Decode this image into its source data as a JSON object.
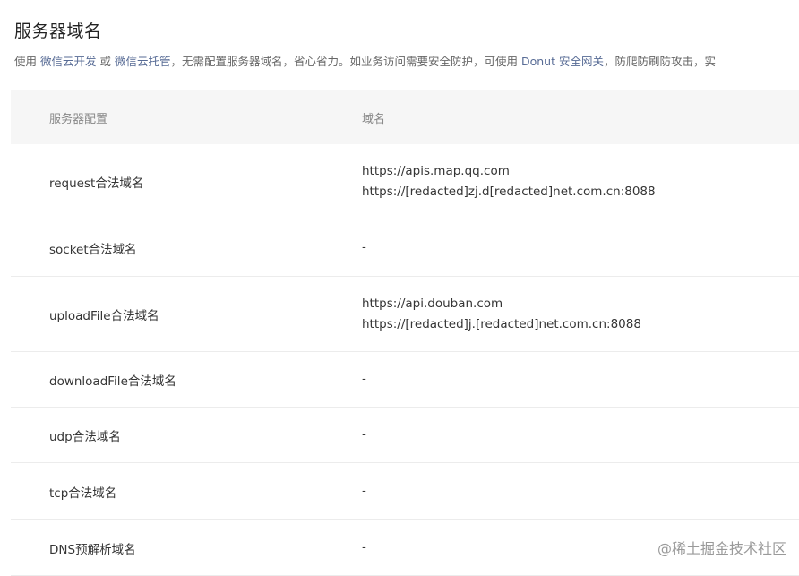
{
  "title": "服务器域名",
  "description": {
    "prefix": "使用 ",
    "link1": "微信云开发",
    "mid1": " 或 ",
    "link2": "微信云托管",
    "mid2": "，无需配置服务器域名，省心省力。如业务访问需要安全防护，可使用 ",
    "link3": "Donut 安全网关",
    "suffix": "，防爬防刷防攻击，实"
  },
  "table": {
    "headers": {
      "config": "服务器配置",
      "domain": "域名"
    },
    "rows": [
      {
        "name": "request合法域名",
        "values": [
          "https://apis.map.qq.com",
          "https://[redacted]zj.d[redacted]net.com.cn:8088"
        ]
      },
      {
        "name": "socket合法域名",
        "values": [
          "-"
        ]
      },
      {
        "name": "uploadFile合法域名",
        "values": [
          "https://api.douban.com",
          "https://[redacted]j.[redacted]net.com.cn:8088"
        ]
      },
      {
        "name": "downloadFile合法域名",
        "values": [
          "-"
        ]
      },
      {
        "name": "udp合法域名",
        "values": [
          "-"
        ]
      },
      {
        "name": "tcp合法域名",
        "values": [
          "-"
        ]
      },
      {
        "name": "DNS预解析域名",
        "values": [
          "-"
        ]
      }
    ]
  },
  "watermark": "@稀土掘金技术社区"
}
